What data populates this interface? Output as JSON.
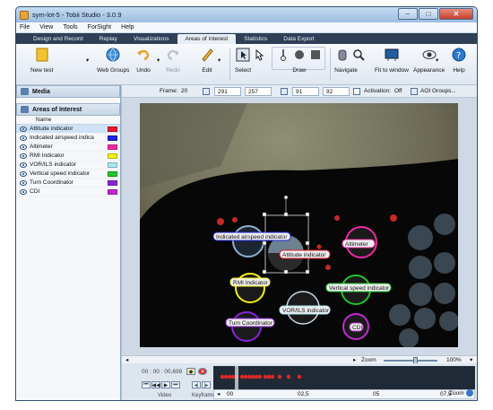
{
  "window": {
    "title": "sym-lot-5 - Tobii Studio - 3.0.9"
  },
  "menu": [
    "File",
    "View",
    "Tools",
    "ForSight",
    "Help"
  ],
  "tabs": [
    {
      "label": "Design and Record"
    },
    {
      "label": "Replay"
    },
    {
      "label": "Visualizations"
    },
    {
      "label": "Areas of Interest"
    },
    {
      "label": "Statistics"
    },
    {
      "label": "Data Export"
    }
  ],
  "toolbar": {
    "new_test": "New test",
    "web_groups": "Web Groups",
    "undo": "Undo",
    "redo": "Redo",
    "edit": "Edit",
    "select": "Select",
    "draw": "Draw",
    "navigate": "Navigate",
    "fit_to_window": "Fit to window",
    "appearance": "Appearance",
    "help": "Help"
  },
  "left_pane": {
    "media_header": "Media",
    "aoi_header": "Areas of Interest",
    "name_column": "Name",
    "aois": [
      {
        "name": "Attitude indicator",
        "color": "#e8182c",
        "selected": true
      },
      {
        "name": "Indicated airspeed indica",
        "color": "#1a24e0",
        "selected": false
      },
      {
        "name": "Altimeter",
        "color": "#ee2aa6",
        "selected": false
      },
      {
        "name": "RMI Indicator",
        "color": "#f4ee18",
        "selected": false
      },
      {
        "name": "VOR/ILS indicator",
        "color": "#a8e8f0",
        "selected": false
      },
      {
        "name": "Vertical speed indicator",
        "color": "#22c42e",
        "selected": false
      },
      {
        "name": "Turn Coordinator",
        "color": "#8a24d8",
        "selected": false
      },
      {
        "name": "CDI",
        "color": "#c02ad0",
        "selected": false
      }
    ]
  },
  "framebar": {
    "frame_label": "Frame:",
    "frame_value": "20",
    "pos_x": "291",
    "pos_y": "257",
    "size_w": "91",
    "size_h": "92",
    "activation_label": "Activation:",
    "activation_value": "Off",
    "aoi_groups": "AOI Groups..."
  },
  "stimulus_labels": [
    {
      "text": "Indicated airspeed indicator",
      "color": "#1a24e0"
    },
    {
      "text": "Attitude indicator",
      "color": "#e8182c"
    },
    {
      "text": "Altimeter",
      "color": "#ee2aa6"
    },
    {
      "text": "RMI Indicator",
      "color": "#f4ee18"
    },
    {
      "text": "Vertical speed indicator",
      "color": "#22c42e"
    },
    {
      "text": "VOR/ILS indicator",
      "color": "#a8e8f0"
    },
    {
      "text": "Turn Coordinator",
      "color": "#8a24d8"
    },
    {
      "text": "CDI",
      "color": "#c02ad0"
    }
  ],
  "zoom": {
    "label": "Zoom",
    "value": "100%"
  },
  "timeline": {
    "time": "00 : 00 : 00,699",
    "video_label": "Video",
    "keyframes_label": "Keyframes",
    "ticks": [
      "00",
      "02,5",
      "05",
      "07,5"
    ],
    "zoom_label": "Zoom"
  }
}
